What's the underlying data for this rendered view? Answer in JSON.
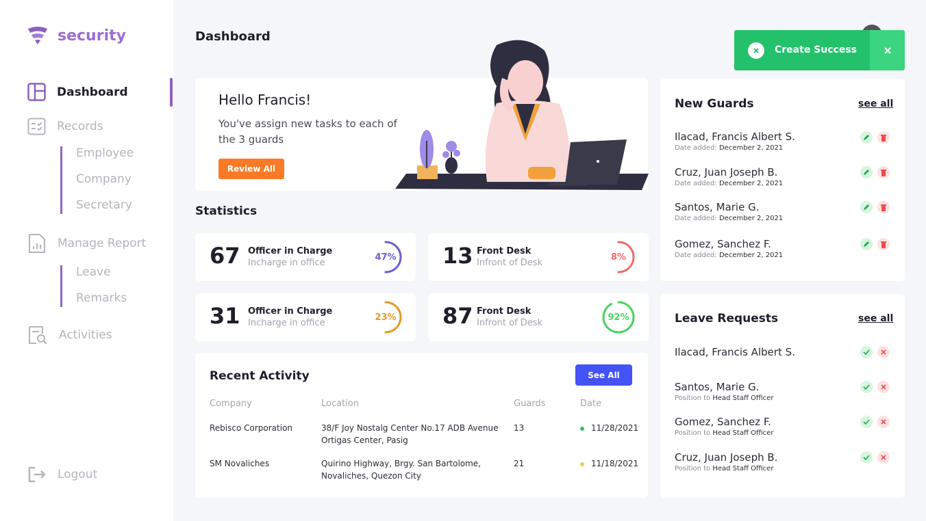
{
  "brand": {
    "name": "security",
    "color": "#9b6fcf"
  },
  "sidebar": {
    "items": [
      {
        "label": "Dashboard",
        "icon": "dashboard-icon"
      },
      {
        "label": "Records",
        "icon": "records-icon"
      },
      {
        "label": "Manage Report",
        "icon": "report-icon"
      },
      {
        "label": "Activities",
        "icon": "activities-icon"
      },
      {
        "label": "Logout",
        "icon": "logout-icon"
      }
    ],
    "records_sub": [
      "Employee",
      "Company",
      "Secretary"
    ],
    "report_sub": [
      "Leave",
      "Remarks"
    ]
  },
  "header": {
    "title": "Dashboard"
  },
  "hero": {
    "greeting": "Hello Francis!",
    "message": "You've assign new tasks to each of the 3 guards",
    "button": "Review All"
  },
  "stats": {
    "title": "Statistics",
    "cards": [
      {
        "value": "67",
        "label": "Officer in Charge",
        "sub": "Incharge in office",
        "percent": "47%",
        "fraction": 0.47,
        "color": "#6a60d4"
      },
      {
        "value": "13",
        "label": "Front Desk",
        "sub": "Infront of Desk",
        "percent": "8%",
        "fraction": 0.08,
        "color": "#ef6a6a"
      },
      {
        "value": "31",
        "label": "Officer in Charge",
        "sub": "Incharge in office",
        "percent": "23%",
        "fraction": 0.23,
        "color": "#e39a2a"
      },
      {
        "value": "87",
        "label": "Front Desk",
        "sub": "Infront of Desk",
        "percent": "92%",
        "fraction": 0.92,
        "color": "#47d35e"
      }
    ]
  },
  "activity": {
    "title": "Recent Activity",
    "button": "See All",
    "columns": [
      "Company",
      "Location",
      "Guards",
      "Date"
    ],
    "rows": [
      {
        "company": "Rebisco Corporation",
        "location": "38/F Joy Nostalg Center No.17 ADB Avenue Ortigas Center, Pasig",
        "guards": "13",
        "date": "11/28/2021",
        "status_color": "#2bc26b"
      },
      {
        "company": "SM Novaliches",
        "location": "Quirino Highway, Brgy. San Bartolome, Novaliches, Quezon City",
        "guards": "21",
        "date": "11/18/2021",
        "status_color": "#f2c94c"
      }
    ]
  },
  "new_guards": {
    "title": "New Guards",
    "link": "see all",
    "meta_label": "Date added:",
    "items": [
      {
        "name": "Ilacad, Francis Albert S.",
        "date": "December 2, 2021"
      },
      {
        "name": "Cruz, Juan Joseph B.",
        "date": "December 2, 2021"
      },
      {
        "name": "Santos, Marie G.",
        "date": "December 2, 2021"
      },
      {
        "name": "Gomez, Sanchez F.",
        "date": "December 2, 2021"
      }
    ]
  },
  "leave_requests": {
    "title": "Leave Requests",
    "link": "see all",
    "meta_label": "Position to",
    "items": [
      {
        "name": "Ilacad, Francis Albert S.",
        "position": ""
      },
      {
        "name": "Santos, Marie G.",
        "position": "Head Staff Officer"
      },
      {
        "name": "Gomez, Sanchez F.",
        "position": "Head Staff Officer"
      },
      {
        "name": "Cruz, Juan Joseph B.",
        "position": "Head Staff Officer"
      }
    ]
  },
  "toast": {
    "message": "Create Success",
    "color": "#23c16b"
  }
}
